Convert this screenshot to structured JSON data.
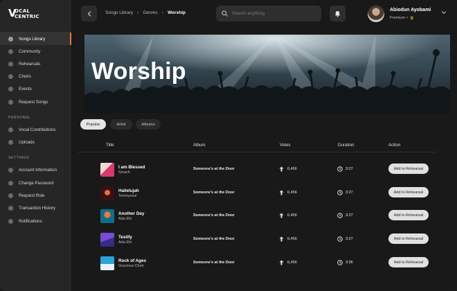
{
  "app": {
    "logo_line1": "OCAL",
    "logo_line2": "CENTRIC",
    "logo_mark": "V"
  },
  "sidebar": {
    "main_items": [
      {
        "label": "Songs Library",
        "active": true
      },
      {
        "label": "Community",
        "active": false
      },
      {
        "label": "Rehearsals",
        "active": false
      },
      {
        "label": "Choirs",
        "active": false
      },
      {
        "label": "Events",
        "active": false
      },
      {
        "label": "Request Songs",
        "active": false
      }
    ],
    "personal_label": "PERSONAL",
    "personal_items": [
      {
        "label": "Vocal Contributions"
      },
      {
        "label": "Uploads"
      }
    ],
    "settings_label": "SETTINGS",
    "settings_items": [
      {
        "label": "Account Information"
      },
      {
        "label": "Change Password"
      },
      {
        "label": "Request Role"
      },
      {
        "label": "Transaction History"
      },
      {
        "label": "Notifications"
      }
    ]
  },
  "header": {
    "breadcrumb": [
      "Songs Library",
      "Genres",
      "Worship"
    ],
    "search_placeholder": "Search anything",
    "user_name": "Abiodun Ayobami",
    "user_plan": "Premium",
    "user_plan_sep": "•"
  },
  "banner": {
    "title": "Worship"
  },
  "filters": [
    "Popular",
    "Artist",
    "Albums"
  ],
  "table": {
    "headers": {
      "title": "Title",
      "album": "Album",
      "votes": "Votes",
      "duration": "Duration",
      "action": "Action"
    },
    "rows": [
      {
        "title": "I am Blessed",
        "artist": "Sinach",
        "album": "Someone's at the Door",
        "votes": "6,456",
        "duration": "3:27",
        "action": "Add to Rehearsal"
      },
      {
        "title": "Hallelujah",
        "artist": "Tenmysoul",
        "album": "Someone's at the Door",
        "votes": "6,456",
        "duration": "3:27",
        "action": "Add to Rehearsal"
      },
      {
        "title": "Another Day",
        "artist": "Ada Ehi",
        "album": "Someone's at the Door",
        "votes": "6,456",
        "duration": "3:27",
        "action": "Add to Rehearsal"
      },
      {
        "title": "Testify",
        "artist": "Ada Ehi",
        "album": "Someone's at the Door",
        "votes": "6,456",
        "duration": "3:27",
        "action": "Add to Rehearsal"
      },
      {
        "title": "Rock of Ages",
        "artist": "Gracious Choir",
        "album": "Someone's at the Door",
        "votes": "6,456",
        "duration": "3:36",
        "action": "Add to Rehearsal"
      }
    ]
  },
  "colors": {
    "accent": "#e07a3a",
    "crown": "#f2c230",
    "sidebar_bg": "#262626",
    "main_bg": "#191919"
  }
}
